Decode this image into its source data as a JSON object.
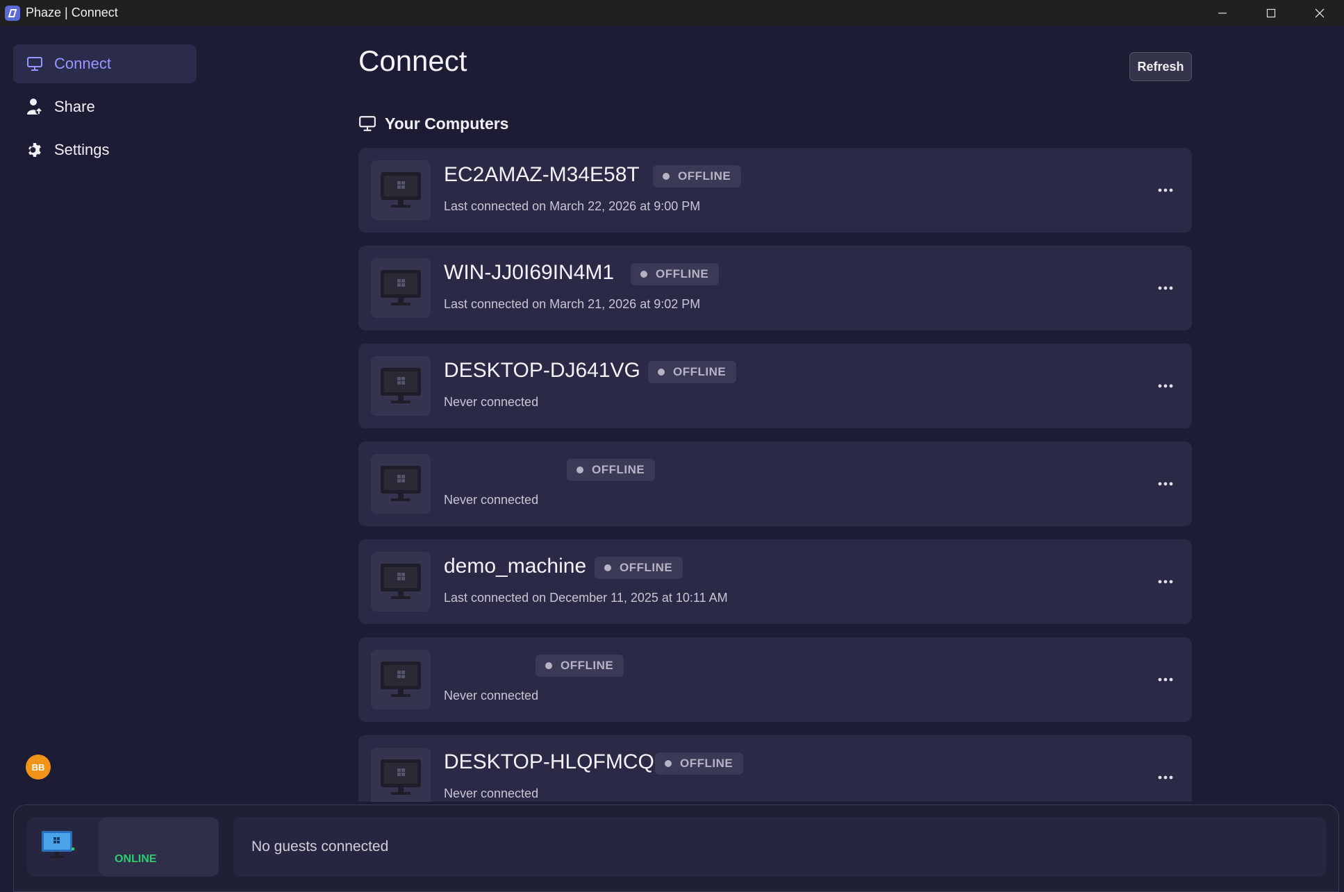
{
  "window": {
    "title": "Phaze | Connect"
  },
  "sidebar": {
    "items": [
      {
        "label": "Connect",
        "icon": "monitor-icon",
        "active": true
      },
      {
        "label": "Share",
        "icon": "share-users-icon",
        "active": false
      },
      {
        "label": "Settings",
        "icon": "gear-icon",
        "active": false
      }
    ],
    "avatar_initials": "BB"
  },
  "main": {
    "title": "Connect",
    "refresh_label": "Refresh",
    "section_title": "Your Computers",
    "computers": [
      {
        "name": "EC2AMAZ-M34E58T",
        "status": "OFFLINE",
        "last": "Last connected on March 22, 2026 at 9:00 PM"
      },
      {
        "name": "WIN-JJ0I69IN4M1",
        "status": "OFFLINE",
        "last": "Last connected on March 21, 2026 at 9:02 PM"
      },
      {
        "name": "DESKTOP-DJ641VG",
        "status": "OFFLINE",
        "last": "Never connected"
      },
      {
        "name": "",
        "status": "OFFLINE",
        "last": "Never connected"
      },
      {
        "name": "demo_machine",
        "status": "OFFLINE",
        "last": "Last connected on December 11, 2025 at 10:11 AM"
      },
      {
        "name": "",
        "status": "OFFLINE",
        "last": "Never connected"
      },
      {
        "name": "DESKTOP-HLQFMCQ",
        "status": "OFFLINE",
        "last": "Never connected"
      }
    ]
  },
  "bottom_bar": {
    "host_status": "ONLINE",
    "guests_text": "No guests connected"
  },
  "colors": {
    "background": "#1c1c35",
    "card": "#2a2a46",
    "accent": "#9b96ff",
    "online": "#2ecc71",
    "avatar": "#f29418"
  }
}
